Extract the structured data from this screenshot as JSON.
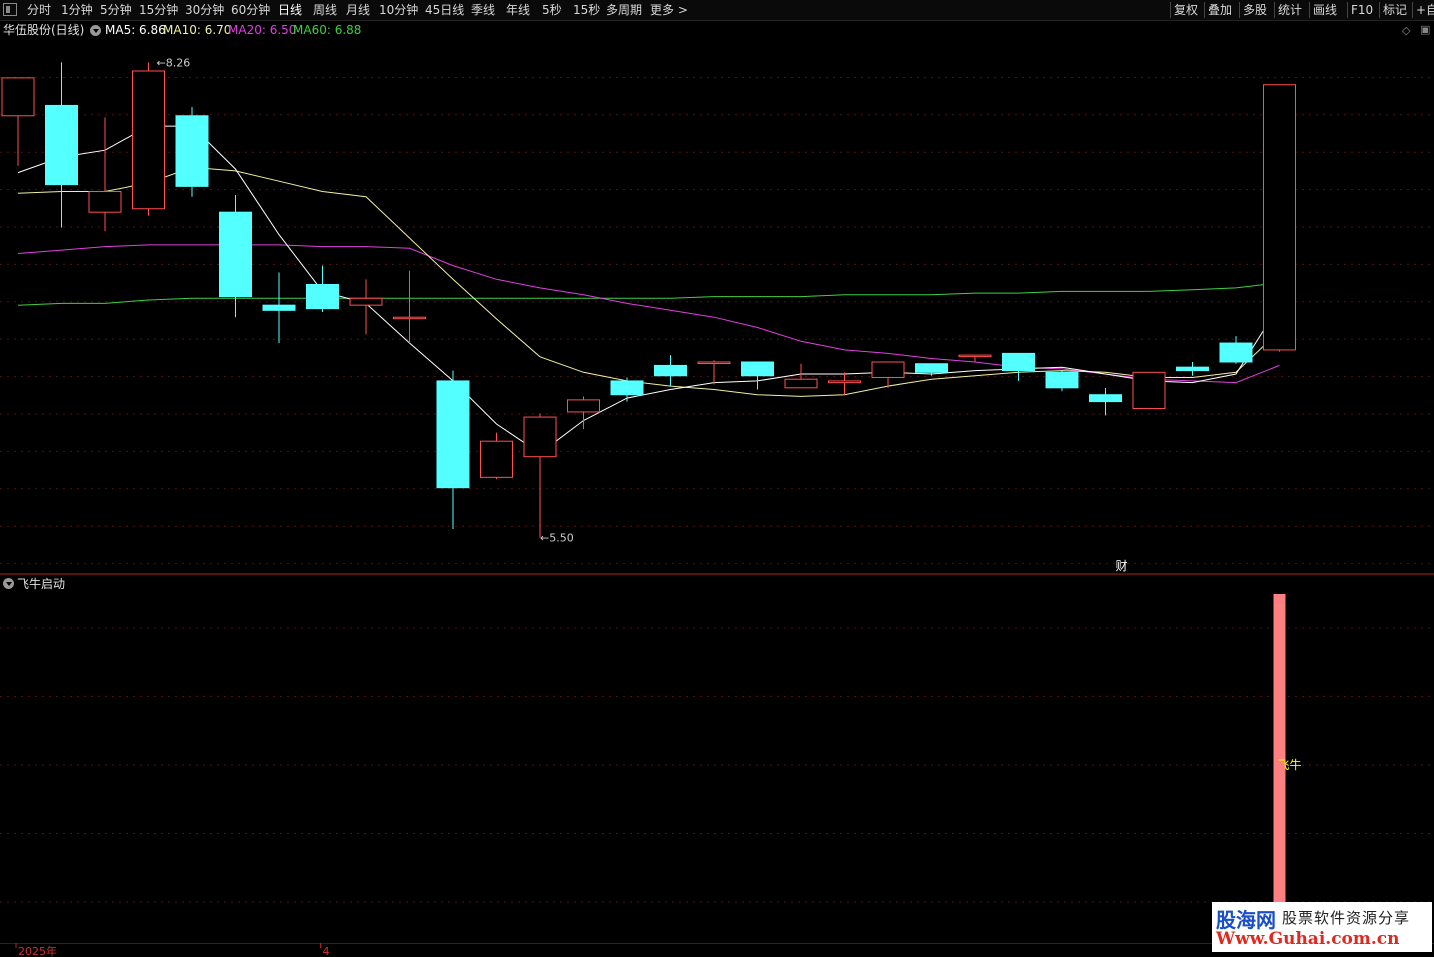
{
  "toolbar": {
    "periods": [
      "分时",
      "1分钟",
      "5分钟",
      "15分钟",
      "30分钟",
      "60分钟",
      "日线",
      "周线",
      "月线",
      "10分钟",
      "45日线",
      "季线",
      "年线",
      "5秒",
      "15秒",
      "多周期",
      "更多 >"
    ],
    "active_period": "日线",
    "right_tools": [
      "复权",
      "叠加",
      "多股",
      "统计",
      "画线",
      "F10",
      "标记",
      "+自"
    ]
  },
  "main_chart": {
    "stock_name": "华伍股份(日线)",
    "ma_labels": [
      {
        "text": "MA5: 6.86",
        "color": "#ffffff"
      },
      {
        "text": "MA10: 6.70",
        "color": "#f0f0a0"
      },
      {
        "text": "MA20: 6.50",
        "color": "#e040e0"
      },
      {
        "text": "MA60: 6.88",
        "color": "#40d040"
      }
    ],
    "high_label": "8.26",
    "low_label": "5.50",
    "finance_marker": "财",
    "colors": {
      "up": "#ff5050",
      "down": "#54ffff",
      "ma5": "#ffffff",
      "ma10": "#f0f0a0",
      "ma20": "#e040e0",
      "ma60": "#40d040",
      "grid": "#5a1010",
      "frame": "#b02020"
    }
  },
  "chart_data": {
    "type": "candlestick",
    "price_range": [
      5.37,
      8.39
    ],
    "candles": [
      {
        "o": 7.95,
        "h": 8.1,
        "l": 7.66,
        "c": 8.17
      },
      {
        "o": 8.01,
        "h": 8.26,
        "l": 7.3,
        "c": 7.55
      },
      {
        "o": 7.39,
        "h": 7.94,
        "l": 7.28,
        "c": 7.51
      },
      {
        "o": 7.41,
        "h": 8.26,
        "l": 7.37,
        "c": 8.21
      },
      {
        "o": 7.95,
        "h": 8.0,
        "l": 7.48,
        "c": 7.54
      },
      {
        "o": 7.39,
        "h": 7.49,
        "l": 6.78,
        "c": 6.9
      },
      {
        "o": 6.85,
        "h": 7.04,
        "l": 6.63,
        "c": 6.82
      },
      {
        "o": 6.97,
        "h": 7.08,
        "l": 6.81,
        "c": 6.83
      },
      {
        "o": 6.85,
        "h": 7.0,
        "l": 6.68,
        "c": 6.89
      },
      {
        "o": 6.78,
        "h": 7.05,
        "l": 6.63,
        "c": 6.78
      },
      {
        "o": 6.41,
        "h": 6.47,
        "l": 5.55,
        "c": 5.79
      },
      {
        "o": 5.85,
        "h": 6.11,
        "l": 5.84,
        "c": 6.06
      },
      {
        "o": 5.97,
        "h": 6.22,
        "l": 5.5,
        "c": 6.2
      },
      {
        "o": 6.23,
        "h": 6.32,
        "l": 6.13,
        "c": 6.3
      },
      {
        "o": 6.41,
        "h": 6.43,
        "l": 6.29,
        "c": 6.33
      },
      {
        "o": 6.5,
        "h": 6.56,
        "l": 6.38,
        "c": 6.44
      },
      {
        "o": 6.52,
        "h": 6.53,
        "l": 6.39,
        "c": 6.52
      },
      {
        "o": 6.52,
        "h": 6.52,
        "l": 6.36,
        "c": 6.44
      },
      {
        "o": 6.37,
        "h": 6.51,
        "l": 6.38,
        "c": 6.42
      },
      {
        "o": 6.4,
        "h": 6.46,
        "l": 6.33,
        "c": 6.41
      },
      {
        "o": 6.43,
        "h": 6.52,
        "l": 6.37,
        "c": 6.52
      },
      {
        "o": 6.51,
        "h": 6.45,
        "l": 6.44,
        "c": 6.46
      },
      {
        "o": 6.56,
        "h": 6.56,
        "l": 6.52,
        "c": 6.56
      },
      {
        "o": 6.57,
        "h": 6.51,
        "l": 6.41,
        "c": 6.47
      },
      {
        "o": 6.46,
        "h": 6.47,
        "l": 6.35,
        "c": 6.37
      },
      {
        "o": 6.33,
        "h": 6.37,
        "l": 6.21,
        "c": 6.29
      },
      {
        "o": 6.25,
        "h": 6.42,
        "l": 6.4,
        "c": 6.46
      },
      {
        "o": 6.49,
        "h": 6.52,
        "l": 6.44,
        "c": 6.47
      },
      {
        "o": 6.63,
        "h": 6.67,
        "l": 6.51,
        "c": 6.52
      },
      {
        "o": 6.59,
        "h": 8.13,
        "l": 6.58,
        "c": 8.13
      }
    ],
    "ma5": [
      7.62,
      7.71,
      7.75,
      7.89,
      7.89,
      7.64,
      7.26,
      6.93,
      6.86,
      6.63,
      6.41,
      6.16,
      5.99,
      6.18,
      6.31,
      6.36,
      6.4,
      6.41,
      6.45,
      6.45,
      6.46,
      6.45,
      6.47,
      6.48,
      6.49,
      6.45,
      6.41,
      6.4,
      6.45,
      6.85
    ],
    "ma10": [
      7.5,
      7.51,
      7.51,
      7.56,
      7.65,
      7.63,
      7.57,
      7.51,
      7.48,
      7.24,
      7.0,
      6.77,
      6.55,
      6.46,
      6.41,
      6.38,
      6.36,
      6.33,
      6.32,
      6.33,
      6.38,
      6.42,
      6.44,
      6.46,
      6.47,
      6.46,
      6.43,
      6.43,
      6.46,
      6.7
    ],
    "ma20": [
      7.15,
      7.17,
      7.19,
      7.2,
      7.2,
      7.2,
      7.2,
      7.19,
      7.19,
      7.18,
      7.08,
      7.0,
      6.95,
      6.91,
      6.86,
      6.82,
      6.78,
      6.72,
      6.64,
      6.59,
      6.57,
      6.54,
      6.52,
      6.49,
      6.48,
      6.45,
      6.42,
      6.41,
      6.4,
      6.5
    ],
    "ma60": [
      6.85,
      6.86,
      6.86,
      6.88,
      6.89,
      6.89,
      6.89,
      6.89,
      6.89,
      6.89,
      6.89,
      6.89,
      6.89,
      6.89,
      6.89,
      6.89,
      6.9,
      6.9,
      6.9,
      6.91,
      6.91,
      6.91,
      6.92,
      6.92,
      6.93,
      6.93,
      6.93,
      6.94,
      6.95,
      6.98
    ],
    "indicator": {
      "name": "飞牛启动",
      "signal_index": 29,
      "signal_label": "飞牛"
    }
  },
  "sub_chart": {
    "title": "飞牛启动",
    "signal_label": "飞牛",
    "signal_color": "#ff8080",
    "label_color": "#ffff00"
  },
  "date_axis": {
    "labels": [
      {
        "text": "2025年",
        "index": 0
      },
      {
        "text": "4",
        "index": 7
      }
    ]
  },
  "watermark": {
    "logo": "股海网",
    "tagline": "股票软件资源分享",
    "url": "Www.Guhai.com.cn"
  }
}
